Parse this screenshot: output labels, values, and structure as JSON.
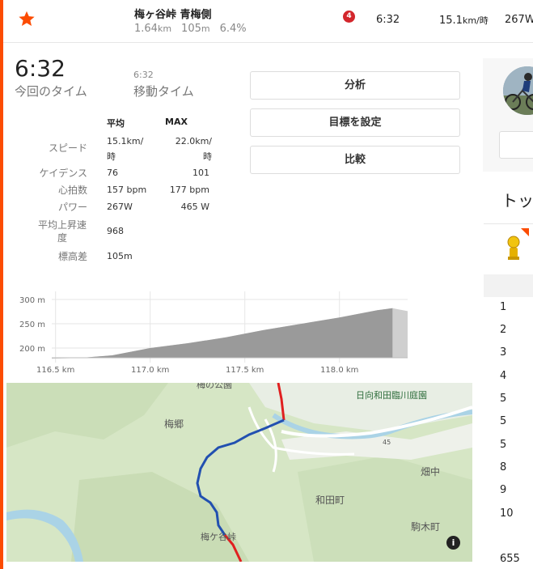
{
  "header": {
    "segment_name": "梅ヶ谷峠 青梅側",
    "distance_value": "1.64",
    "distance_unit": "km",
    "elev_value": "105",
    "elev_unit": "m",
    "grade": "6.4%",
    "badge": "4",
    "time": "6:32",
    "speed_value": "15.1",
    "speed_unit": "km/時",
    "power": "267W"
  },
  "stats": {
    "time_value": "6:32",
    "time_label": "今回のタイム",
    "moving_time_value": "6:32",
    "moving_time_label": "移動タイム",
    "col_avg": "平均",
    "col_max": "MAX",
    "rows": [
      {
        "label": "スピード",
        "avg": "15.1km/時",
        "max": "22.0km/時"
      },
      {
        "label": "ケイデンス",
        "avg": "76",
        "max": "101"
      },
      {
        "label": "心拍数",
        "avg": "157 bpm",
        "max": "177 bpm"
      },
      {
        "label": "パワー",
        "avg": "267W",
        "max": "465 W"
      },
      {
        "label": "平均上昇速度",
        "avg": "968",
        "max": ""
      },
      {
        "label": "標高差",
        "avg": "105m",
        "max": ""
      }
    ]
  },
  "buttons": {
    "analyze": "分析",
    "set_goal": "目標を設定",
    "compare": "比較"
  },
  "right_panel": {
    "heading": "トッ",
    "ranks": [
      "1",
      "2",
      "3",
      "4",
      "5",
      "5",
      "5",
      "8",
      "9",
      "10",
      "655"
    ]
  },
  "chart_data": {
    "type": "area",
    "xlabel": "",
    "ylabel": "",
    "y_ticks": [
      "300 m",
      "250 m",
      "200 m"
    ],
    "x_ticks": [
      "116.5 km",
      "117.0 km",
      "117.5 km",
      "118.0 km"
    ],
    "xlim": [
      116.48,
      118.36
    ],
    "ylim": [
      180,
      310
    ],
    "segment_range": [
      116.64,
      118.28
    ],
    "x": [
      116.48,
      116.64,
      116.8,
      117.0,
      117.2,
      117.4,
      117.6,
      117.8,
      118.0,
      118.2,
      118.28,
      118.36
    ],
    "y": [
      178,
      180,
      185,
      200,
      210,
      222,
      237,
      250,
      263,
      278,
      282,
      276
    ],
    "colors": {
      "segment": "#9a9a9a",
      "outside": "#cfcfcf"
    },
    "grid": true
  },
  "map": {
    "labels": [
      "梅の公園",
      "日向和田臨川庭園",
      "梅郷",
      "45",
      "畑中",
      "和田町",
      "駒木町",
      "梅ケ谷峠"
    ],
    "info_icon": "i"
  }
}
